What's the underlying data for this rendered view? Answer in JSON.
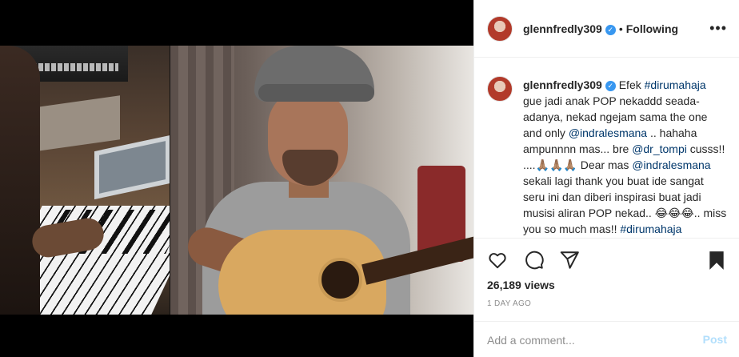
{
  "post": {
    "username": "glennfredly309",
    "verified_mark": "✓",
    "separator": "•",
    "follow_status": "Following",
    "more_icon": "•••"
  },
  "caption": {
    "username": "glennfredly309",
    "segments": [
      {
        "type": "text",
        "text": " Efek "
      },
      {
        "type": "link",
        "text": "#dirumahaja"
      },
      {
        "type": "text",
        "text": " gue jadi anak POP nekaddd seada-adanya, nekad ngejam sama the one and only "
      },
      {
        "type": "link",
        "text": "@indralesmana"
      },
      {
        "type": "text",
        "text": " .. hahaha ampunnnn mas... bre "
      },
      {
        "type": "link",
        "text": "@dr_tompi"
      },
      {
        "type": "text",
        "text": " cusss!! ....🙏🏽🙏🏽🙏🏽 Dear mas "
      },
      {
        "type": "link",
        "text": "@indralesmana"
      },
      {
        "type": "text",
        "text": " sekali lagi thank you buat ide sangat seru ini dan diberi inspirasi buat jadi musisi aliran POP nekad.. 😂😂😂.. miss you so much mas!! "
      },
      {
        "type": "link",
        "text": "#dirumahaja"
      }
    ]
  },
  "actions": {
    "icons": [
      "heart-icon",
      "comment-icon",
      "share-icon",
      "bookmark-icon"
    ],
    "views": "26,189 views",
    "timestamp": "1 DAY AGO"
  },
  "comment": {
    "placeholder": "Add a comment...",
    "post_label": "Post"
  },
  "colors": {
    "link": "#00376b",
    "verified": "#3897f0",
    "post_disabled": "#b2dffc",
    "muted": "#8e8e8e"
  }
}
